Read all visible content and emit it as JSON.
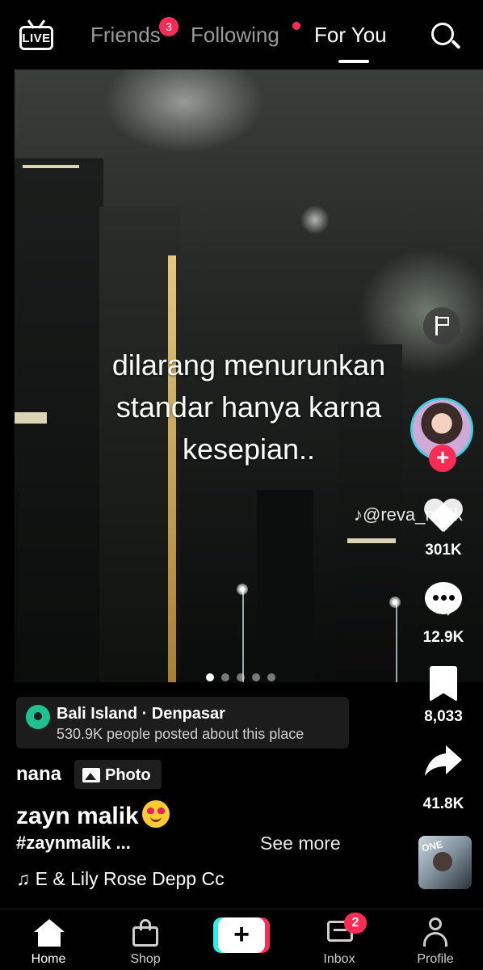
{
  "topbar": {
    "live_label": "LIVE",
    "tabs": [
      {
        "label": "Friends",
        "badge": "3"
      },
      {
        "label": "Following",
        "has_dot": true
      },
      {
        "label": "For You",
        "active": true
      }
    ]
  },
  "post": {
    "caption_lines": [
      "dilarang menurunkan",
      "standar hanya karna",
      "kesepian.."
    ],
    "watermark": "@reva_m_jk",
    "slides_total": 5,
    "slide_active": 1,
    "location": {
      "title": "Bali Island · Denpasar",
      "subtitle": "530.9K people posted about this place"
    },
    "username": "nana",
    "type_tag": "Photo",
    "title": "zayn malik",
    "hashtags": "#zaynmalik ...",
    "see_more": "See more",
    "music": "E & Lily Rose Depp   Cc",
    "music_note": "♫"
  },
  "actions": {
    "likes": "301K",
    "comments": "12.9K",
    "saves": "8,033",
    "shares": "41.8K",
    "follow_plus": "+",
    "disc_label": "ONE"
  },
  "nav": {
    "items": [
      {
        "label": "Home"
      },
      {
        "label": "Shop"
      },
      {
        "label": "+"
      },
      {
        "label": "Inbox",
        "badge": "2"
      },
      {
        "label": "Profile"
      }
    ]
  },
  "colors": {
    "accent": "#fe2c55",
    "cyan": "#25f4ee",
    "location_pin": "#20c191"
  }
}
